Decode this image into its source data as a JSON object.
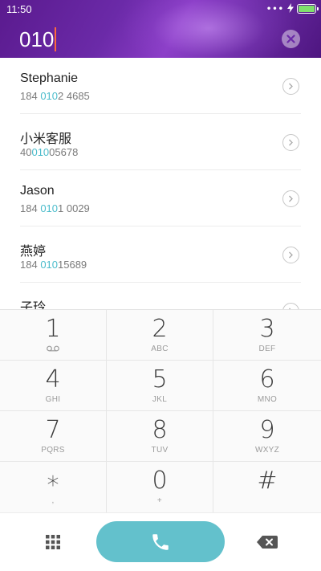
{
  "status_bar": {
    "time": "11:50",
    "signal_dots": "•••",
    "charging_icon": "bolt",
    "battery_level": 1.0,
    "battery_color": "#7fe06c"
  },
  "dialer": {
    "input_value": "010",
    "clear_icon": "close-icon"
  },
  "contacts": [
    {
      "name": "Stephanie",
      "number_prefix": "184 ",
      "number_match": "010",
      "number_suffix": "2 4685"
    },
    {
      "name": "小米客服",
      "number_prefix": "40",
      "number_match": "010",
      "number_suffix": "05678"
    },
    {
      "name": "Jason",
      "number_prefix": "184 ",
      "number_match": "010",
      "number_suffix": "1 0029"
    },
    {
      "name": "燕婷",
      "number_prefix": "184 ",
      "number_match": "010",
      "number_suffix": "15689"
    },
    {
      "name": "子玲",
      "number_prefix": "",
      "number_match": "",
      "number_suffix": ""
    }
  ],
  "keypad": {
    "keys": [
      {
        "digit": "1",
        "sub": ""
      },
      {
        "digit": "2",
        "sub": "ABC"
      },
      {
        "digit": "3",
        "sub": "DEF"
      },
      {
        "digit": "4",
        "sub": "GHI"
      },
      {
        "digit": "5",
        "sub": "JKL"
      },
      {
        "digit": "6",
        "sub": "MNO"
      },
      {
        "digit": "7",
        "sub": "PQRS"
      },
      {
        "digit": "8",
        "sub": "TUV"
      },
      {
        "digit": "9",
        "sub": "WXYZ"
      },
      {
        "digit": "∗",
        "sub": ","
      },
      {
        "digit": "0",
        "sub": "+"
      },
      {
        "digit": "#",
        "sub": ""
      }
    ],
    "voicemail_icon": "voicemail-icon"
  },
  "bottom_bar": {
    "keypad_toggle_icon": "grid-icon",
    "call_icon": "phone-icon",
    "backspace_icon": "backspace-icon",
    "call_color": "#63c1cc"
  },
  "colors": {
    "accent_match": "#4bbccb",
    "header_purple": "#6b2aa8",
    "cursor": "#ff6a3a"
  }
}
